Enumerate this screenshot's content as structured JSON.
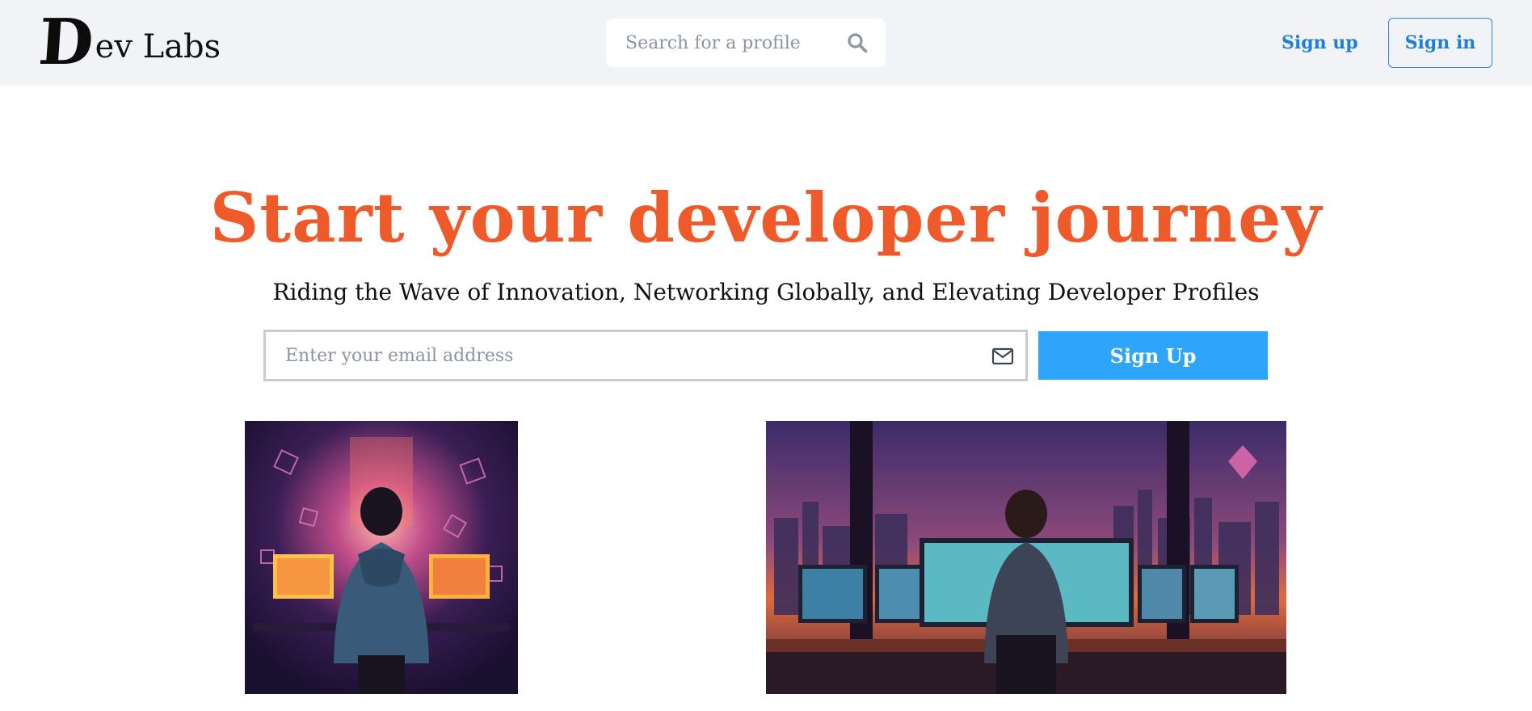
{
  "header": {
    "logo_initial": "D",
    "logo_rest": "ev Labs",
    "search_placeholder": "Search for a profile",
    "nav_signup": "Sign up",
    "nav_signin": "Sign in"
  },
  "hero": {
    "title": "Start your developer journey",
    "subtitle": "Riding the Wave of Innovation, Networking Globally, and Elevating Developer Profiles",
    "email_placeholder": "Enter your email address",
    "cta_label": "Sign Up"
  },
  "colors": {
    "accent_orange": "#ef5a2a",
    "link_blue": "#1e7fd8",
    "cta_blue": "#2ea5fb",
    "header_bg": "#f1f3f7"
  },
  "icons": {
    "search": "search-icon",
    "mail": "mail-icon"
  }
}
